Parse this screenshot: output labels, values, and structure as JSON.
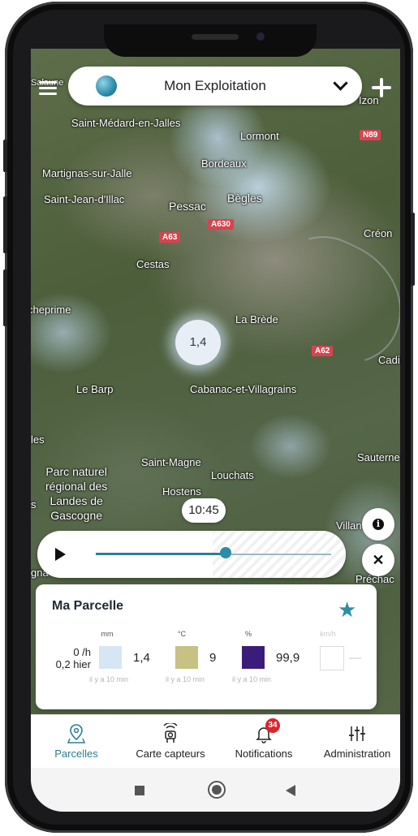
{
  "header": {
    "farm_name": "Mon Exploitation"
  },
  "map": {
    "places": [
      {
        "id": "saint-medard",
        "label": "Saint-Médard-en-Jalles"
      },
      {
        "id": "lormont",
        "label": "Lormont"
      },
      {
        "id": "martignas",
        "label": "Martignas-sur-Jalle"
      },
      {
        "id": "bordeaux",
        "label": "Bordeaux"
      },
      {
        "id": "saint-jean",
        "label": "Saint-Jean-d'Illac"
      },
      {
        "id": "pessac",
        "label": "Pessac"
      },
      {
        "id": "begles",
        "label": "Bègles"
      },
      {
        "id": "creon",
        "label": "Créon"
      },
      {
        "id": "cestas",
        "label": "Cestas"
      },
      {
        "id": "heprime",
        "label": "cheprime"
      },
      {
        "id": "la-brede",
        "label": "La Brède"
      },
      {
        "id": "cadi",
        "label": "Cadi"
      },
      {
        "id": "le-barp",
        "label": "Le Barp"
      },
      {
        "id": "cabanac",
        "label": "Cabanac-et-Villagrains"
      },
      {
        "id": "les",
        "label": "les"
      },
      {
        "id": "sauterne",
        "label": "Sauterne"
      },
      {
        "id": "saint-magne",
        "label": "Saint-Magne"
      },
      {
        "id": "louchats",
        "label": "Louchats"
      },
      {
        "id": "parc",
        "label": "Parc naturel\nrégional des\nLandes de\nGascogne"
      },
      {
        "id": "hostens",
        "label": "Hostens"
      },
      {
        "id": "villan",
        "label": "Villan"
      },
      {
        "id": "prechac",
        "label": "Préchac"
      },
      {
        "id": "izon",
        "label": "Izon"
      },
      {
        "id": "salaunes",
        "label": "Salaune"
      },
      {
        "id": "s",
        "label": "s"
      },
      {
        "id": "igna",
        "label": "gna"
      }
    ],
    "roads": [
      "N89",
      "A630",
      "A63",
      "A62"
    ],
    "cluster_value": "1,4"
  },
  "timeline": {
    "time": "10:45",
    "progress": 0.55
  },
  "parcel": {
    "title": "Ma Parcelle",
    "rain_line1": "0 /h",
    "rain_line2": "0,2 hier",
    "metrics": [
      {
        "unit": "mm",
        "value": "1,4",
        "color": "#d6e6f5",
        "ago": "il y a 10 min"
      },
      {
        "unit": "°C",
        "value": "9",
        "color": "#c7c184",
        "ago": "il y a 10 min"
      },
      {
        "unit": "%",
        "value": "99,9",
        "color": "#3c1c7a",
        "ago": "il y a 10 min"
      },
      {
        "unit": "km/h",
        "value": "—",
        "color": "#ffffff",
        "ago": ""
      }
    ]
  },
  "nav": {
    "items": [
      {
        "label": "Parcelles",
        "icon": "map-pin-icon"
      },
      {
        "label": "Carte capteurs",
        "icon": "sensor-icon"
      },
      {
        "label": "Notifications",
        "icon": "bell-icon"
      },
      {
        "label": "Administration",
        "icon": "sliders-icon"
      }
    ],
    "notifications_badge": "34"
  },
  "colors": {
    "accent": "#2b7f93",
    "badge": "#d7262e"
  }
}
